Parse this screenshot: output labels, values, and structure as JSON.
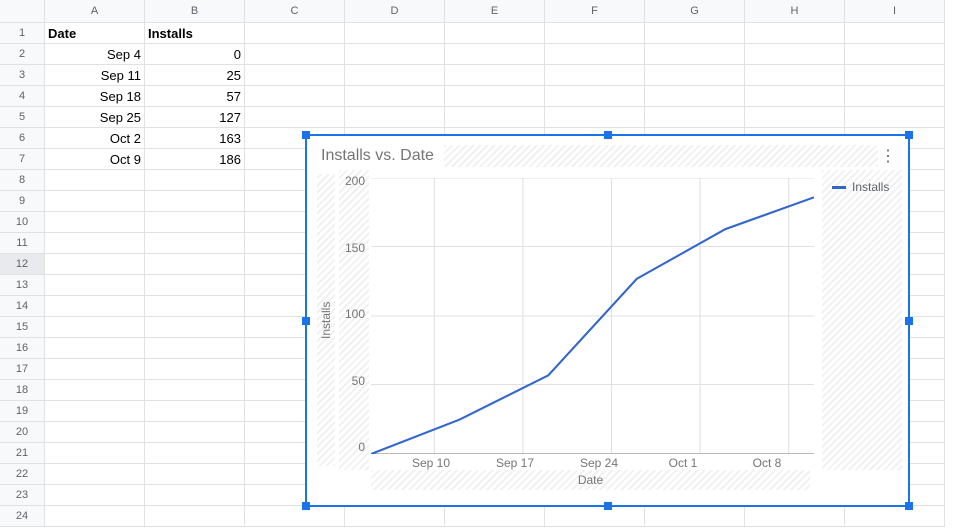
{
  "columns": [
    "A",
    "B",
    "C",
    "D",
    "E",
    "F",
    "G",
    "H",
    "I"
  ],
  "row_numbers": [
    1,
    2,
    3,
    4,
    5,
    6,
    7,
    8,
    9,
    10,
    11,
    12,
    13,
    14,
    15,
    16,
    17,
    18,
    19,
    20,
    21,
    22,
    23,
    24
  ],
  "headers": {
    "A": "Date",
    "B": "Installs"
  },
  "rows": [
    {
      "A": "Sep 4",
      "B": "0"
    },
    {
      "A": "Sep 11",
      "B": "25"
    },
    {
      "A": "Sep 18",
      "B": "57"
    },
    {
      "A": "Sep 25",
      "B": "127"
    },
    {
      "A": "Oct 2",
      "B": "163"
    },
    {
      "A": "Oct 9",
      "B": "186"
    }
  ],
  "selected_row": 12,
  "chart": {
    "title": "Installs vs. Date",
    "ylabel": "Installs",
    "xlabel": "Date",
    "legend": "Installs",
    "yticks": [
      "200",
      "150",
      "100",
      "50",
      "0"
    ],
    "xticks": [
      "Sep 10",
      "Sep 17",
      "Sep 24",
      "Oct 1",
      "Oct 8"
    ]
  },
  "chart_data": {
    "type": "line",
    "x": [
      "Sep 4",
      "Sep 11",
      "Sep 18",
      "Sep 25",
      "Oct 2",
      "Oct 9"
    ],
    "series": [
      {
        "name": "Installs",
        "values": [
          0,
          25,
          57,
          127,
          163,
          186
        ]
      }
    ],
    "title": "Installs vs. Date",
    "xlabel": "Date",
    "ylabel": "Installs",
    "ylim": [
      0,
      200
    ]
  }
}
